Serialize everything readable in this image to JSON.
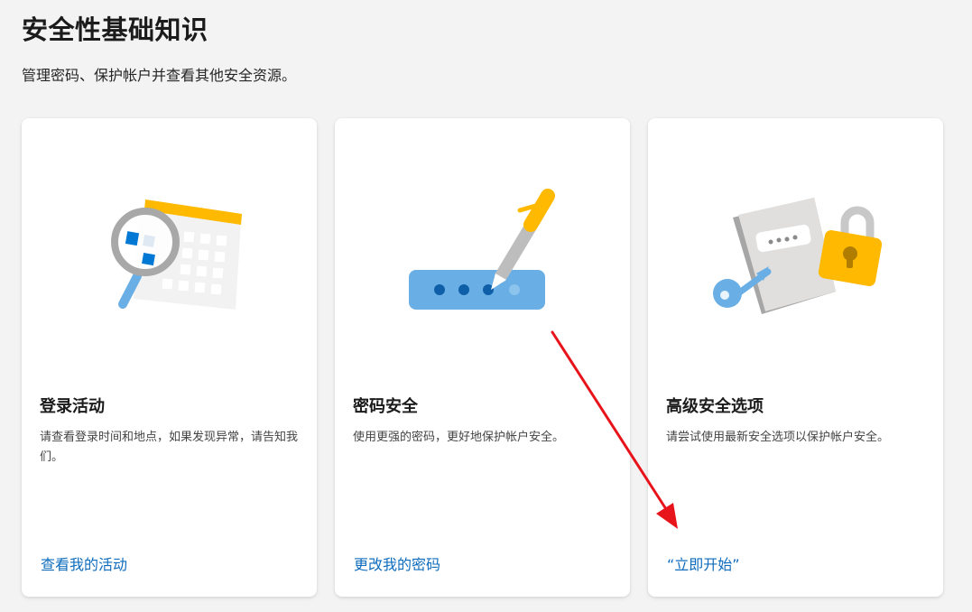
{
  "header": {
    "title": "安全性基础知识",
    "subtitle": "管理密码、保护帐户并查看其他安全资源。"
  },
  "cards": [
    {
      "illustration": "calendar-magnifier-illustration",
      "title": "登录活动",
      "description": "请查看登录时间和地点，如果发现异常，请告知我们。",
      "link": "查看我的活动"
    },
    {
      "illustration": "password-field-pen-illustration",
      "title": "密码安全",
      "description": "使用更强的密码，更好地保护帐户安全。",
      "link": "更改我的密码"
    },
    {
      "illustration": "notebook-key-lock-illustration",
      "title": "高级安全选项",
      "description": "请尝试使用最新安全选项以保护帐户安全。",
      "link": "“立即开始”"
    }
  ],
  "colors": {
    "link": "#0f6cbd",
    "annotation_arrow": "#e8141b",
    "accent_yellow": "#ffb900",
    "accent_blue": "#0078d4"
  }
}
